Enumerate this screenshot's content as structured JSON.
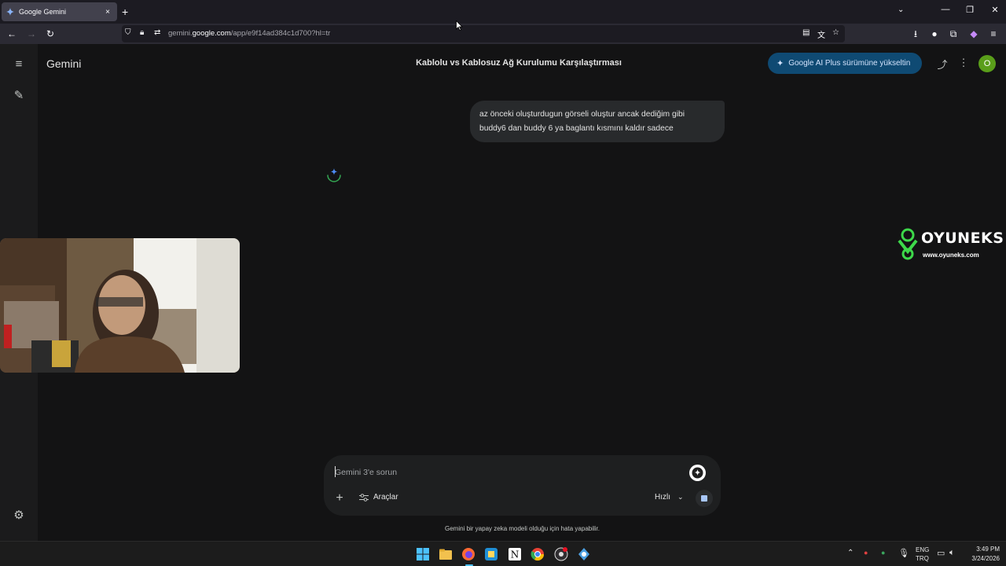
{
  "browser": {
    "tab_title": "Google Gemini",
    "tab_close": "×",
    "new_tab": "+",
    "url_host_prefix": "gemini.",
    "url_host": "google.com",
    "url_path": "/app/e9f14ad384c1d700?hl=tr",
    "window_controls": {
      "minimize": "—",
      "restore": "❐",
      "close": "✕"
    }
  },
  "app": {
    "brand": "Gemini",
    "conversation_title": "Kablolu vs Kablosuz Ağ Kurulumu Karşılaştırması",
    "upgrade_label": "Google AI Plus sürümüne yükseltin",
    "avatar_letter": "O"
  },
  "chat": {
    "user_message_line1": "az önceki oluşturdugun görseli oluştur ancak dediğim gibi",
    "user_message_line2": "buddy6 dan buddy 6 ya baglantı kısmını kaldır sadece"
  },
  "composer": {
    "placeholder": "Gemini 3'e sorun",
    "tools_label": "Araçlar",
    "model_label": "Hızlı",
    "disclaimer": "Gemini bir yapay zeka modeli olduğu için hata yapabilir."
  },
  "watermark": {
    "name": "OYUNEKS",
    "url": "www.oyuneks.com"
  },
  "taskbar": {
    "lang_top": "ENG",
    "lang_bottom": "TRQ",
    "time": "3:49 PM",
    "date": "3/24/2026"
  },
  "colors": {
    "background": "#131314",
    "accent": "#0f4a73",
    "avatar": "#5a9e1a"
  },
  "icons": [
    "menu-icon",
    "new-chat-icon",
    "settings-icon",
    "share-icon",
    "more-vert-icon",
    "gemini-spark-icon",
    "plus-icon",
    "tools-icon",
    "chevron-down-icon",
    "stop-icon"
  ]
}
